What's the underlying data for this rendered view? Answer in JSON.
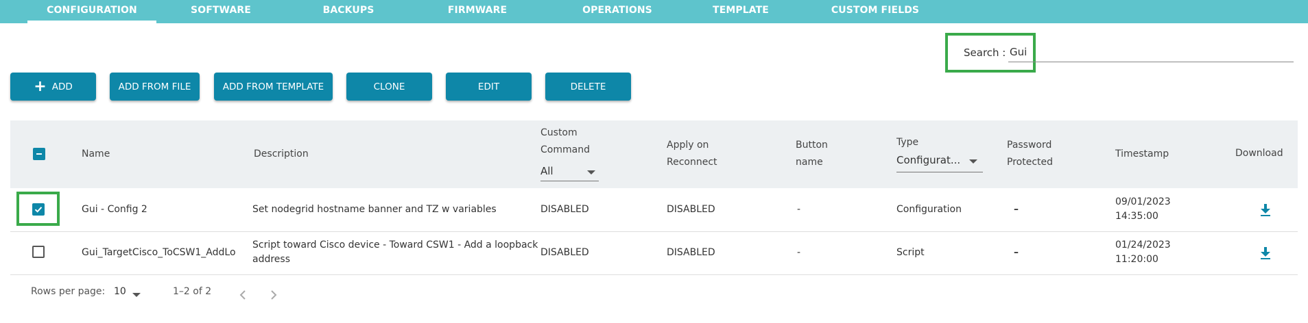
{
  "nav": {
    "tabs": [
      {
        "label": "CONFIGURATION",
        "active": true
      },
      {
        "label": "SOFTWARE"
      },
      {
        "label": "BACKUPS"
      },
      {
        "label": "FIRMWARE"
      },
      {
        "label": "OPERATIONS"
      },
      {
        "label": "TEMPLATE"
      },
      {
        "label": "CUSTOM FIELDS"
      }
    ]
  },
  "search": {
    "label": "Search :",
    "value": "Gui"
  },
  "toolbar": {
    "add": "ADD",
    "add_from_file": "ADD FROM FILE",
    "add_from_template": "ADD FROM TEMPLATE",
    "clone": "CLONE",
    "edit": "EDIT",
    "delete": "DELETE"
  },
  "table": {
    "headers": {
      "name": "Name",
      "description": "Description",
      "custom_command_1": "Custom",
      "custom_command_2": "Command",
      "custom_command_filter": "All",
      "apply_1": "Apply on",
      "apply_2": "Reconnect",
      "button_1": "Button",
      "button_2": "name",
      "type": "Type",
      "type_filter": "Configurat...",
      "password_1": "Password",
      "password_2": "Protected",
      "timestamp": "Timestamp",
      "download": "Download"
    },
    "rows": [
      {
        "checked": true,
        "name": "Gui - Config 2",
        "description_1": "Set nodegrid hostname banner and TZ w variables",
        "description_2": "",
        "custom_command": "DISABLED",
        "apply": "DISABLED",
        "button": "-",
        "type": "Configuration",
        "password": "–",
        "date": "09/01/2023",
        "time": "14:35:00"
      },
      {
        "checked": false,
        "name": "Gui_TargetCisco_ToCSW1_AddLo",
        "description_1": "Script toward Cisco device - Toward CSW1 - Add a loopback",
        "description_2": "address",
        "custom_command": "DISABLED",
        "apply": "DISABLED",
        "button": "-",
        "type": "Script",
        "password": "–",
        "date": "01/24/2023",
        "time": "11:20:00"
      }
    ]
  },
  "footer": {
    "rows_label": "Rows per page:",
    "rows_value": "10",
    "range": "1–2 of 2"
  },
  "colors": {
    "nav": "#5ec4cc",
    "button": "#0e87a8",
    "highlight": "#3aaa4a"
  },
  "icons": [
    "plus-icon",
    "checkbox-indeterminate-icon",
    "checkbox-checked-icon",
    "checkbox-empty-icon",
    "download-icon",
    "chevron-left-icon",
    "chevron-right-icon",
    "caret-down-icon"
  ]
}
